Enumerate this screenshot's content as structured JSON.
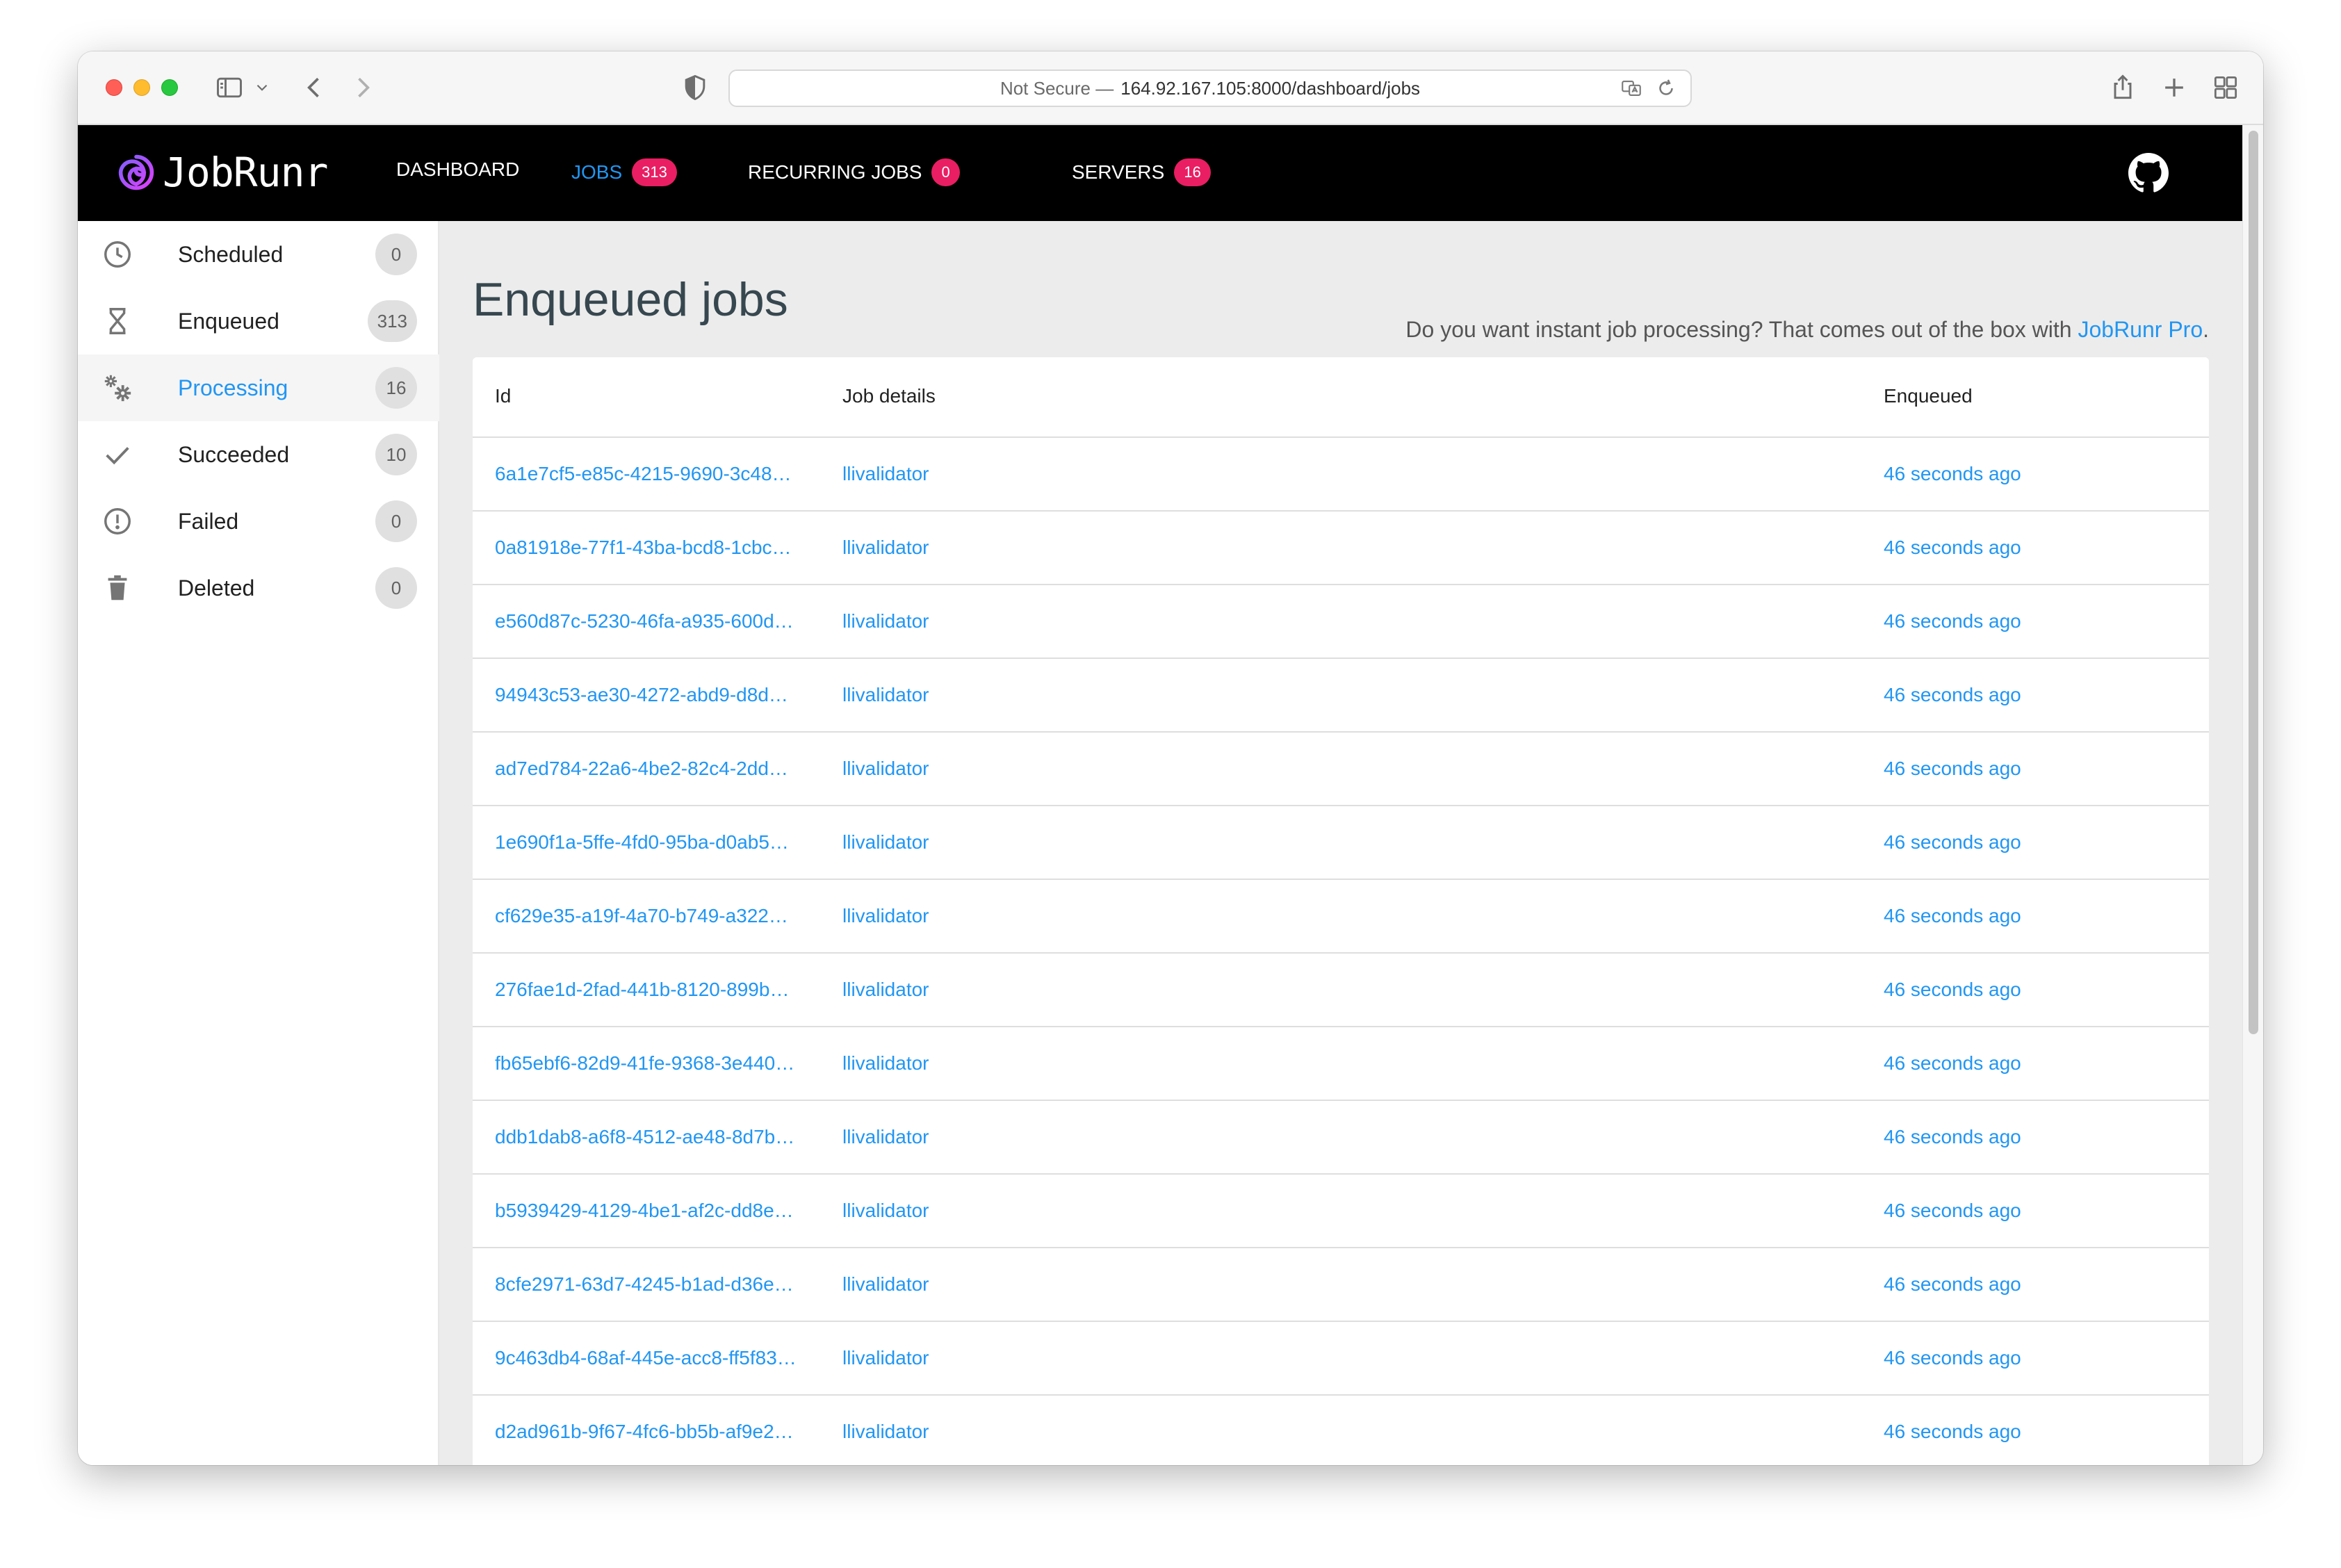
{
  "browser": {
    "url_security": "Not Secure —",
    "url": "164.92.167.105:8000/dashboard/jobs"
  },
  "app": {
    "logo_text": "JobRunr",
    "nav": [
      {
        "label": "DASHBOARD"
      },
      {
        "label": "JOBS",
        "count": "313"
      },
      {
        "label": "RECURRING JOBS",
        "count": "0"
      },
      {
        "label": "SERVERS",
        "count": "16"
      }
    ]
  },
  "sidebar": {
    "items": [
      {
        "label": "Scheduled",
        "count": "0",
        "icon": "clock-icon"
      },
      {
        "label": "Enqueued",
        "count": "313",
        "icon": "hourglass-icon"
      },
      {
        "label": "Processing",
        "count": "16",
        "icon": "gears-icon"
      },
      {
        "label": "Succeeded",
        "count": "10",
        "icon": "check-icon"
      },
      {
        "label": "Failed",
        "count": "0",
        "icon": "alert-circle-icon"
      },
      {
        "label": "Deleted",
        "count": "0",
        "icon": "trash-icon"
      }
    ]
  },
  "page": {
    "title": "Enqueued jobs",
    "promo_text": "Do you want instant job processing? That comes out of the box with ",
    "promo_link": "JobRunr Pro",
    "promo_end": "."
  },
  "table": {
    "headers": {
      "id": "Id",
      "details": "Job details",
      "enqueued": "Enqueued"
    },
    "rows": [
      {
        "id": "6a1e7cf5-e85c-4215-9690-3c48…",
        "details": "llivalidator",
        "enqueued": "46 seconds ago"
      },
      {
        "id": "0a81918e-77f1-43ba-bcd8-1cbc…",
        "details": "llivalidator",
        "enqueued": "46 seconds ago"
      },
      {
        "id": "e560d87c-5230-46fa-a935-600d…",
        "details": "llivalidator",
        "enqueued": "46 seconds ago"
      },
      {
        "id": "94943c53-ae30-4272-abd9-d8d…",
        "details": "llivalidator",
        "enqueued": "46 seconds ago"
      },
      {
        "id": "ad7ed784-22a6-4be2-82c4-2dd…",
        "details": "llivalidator",
        "enqueued": "46 seconds ago"
      },
      {
        "id": "1e690f1a-5ffe-4fd0-95ba-d0ab5…",
        "details": "llivalidator",
        "enqueued": "46 seconds ago"
      },
      {
        "id": "cf629e35-a19f-4a70-b749-a322…",
        "details": "llivalidator",
        "enqueued": "46 seconds ago"
      },
      {
        "id": "276fae1d-2fad-441b-8120-899b…",
        "details": "llivalidator",
        "enqueued": "46 seconds ago"
      },
      {
        "id": "fb65ebf6-82d9-41fe-9368-3e440…",
        "details": "llivalidator",
        "enqueued": "46 seconds ago"
      },
      {
        "id": "ddb1dab8-a6f8-4512-ae48-8d7b…",
        "details": "llivalidator",
        "enqueued": "46 seconds ago"
      },
      {
        "id": "b5939429-4129-4be1-af2c-dd8e…",
        "details": "llivalidator",
        "enqueued": "46 seconds ago"
      },
      {
        "id": "8cfe2971-63d7-4245-b1ad-d36e…",
        "details": "llivalidator",
        "enqueued": "46 seconds ago"
      },
      {
        "id": "9c463db4-68af-445e-acc8-ff5f83…",
        "details": "llivalidator",
        "enqueued": "46 seconds ago"
      },
      {
        "id": "d2ad961b-9f67-4fc6-bb5b-af9e2…",
        "details": "llivalidator",
        "enqueued": "46 seconds ago"
      }
    ]
  },
  "colors": {
    "accent": "#2196f3",
    "badge": "#e91e63",
    "header_bg": "#000000",
    "main_bg": "#ececec"
  }
}
